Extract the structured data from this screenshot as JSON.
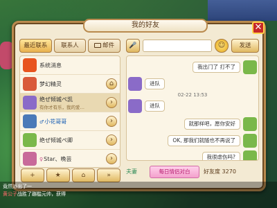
{
  "window": {
    "title": "我的好友",
    "close_symbol": "✕"
  },
  "tabs": [
    {
      "label": "最近联系",
      "active": true
    },
    {
      "label": "联系人",
      "active": false
    },
    {
      "label": "邮件",
      "active": false
    }
  ],
  "contacts": [
    {
      "name": "系统消息",
      "sub": "",
      "badge": "系统",
      "action": "",
      "avatar_color": "#e8541e"
    },
    {
      "name": "梦幻精灵",
      "sub": "",
      "badge": "",
      "action": "⌂",
      "avatar_color": "#d95a3a"
    },
    {
      "name": "绝ぜ倾城ぺ凯",
      "sub": "有你才有乐，我的爱…",
      "badge": "",
      "action": "›",
      "avatar_color": "#8a6bc8",
      "selected": true
    },
    {
      "name": "小花哥哥",
      "sub": "",
      "badge": "",
      "action": "›",
      "avatar_color": "#4a7ab8",
      "gender": "♂"
    },
    {
      "name": "绝ぜ倾城ぺ卿",
      "sub": "",
      "badge": "",
      "action": "›",
      "avatar_color": "#7ab84a"
    },
    {
      "name": "Star、晚芸",
      "sub": "",
      "badge": "",
      "action": "›",
      "avatar_color": "#c86a9a",
      "gender": "♀"
    }
  ],
  "bottom_buttons": [
    "+",
    "★",
    "⌂",
    "»"
  ],
  "chat_input": {
    "mic_symbol": "🎤",
    "placeholder": "",
    "emoji_symbol": "☺",
    "send_label": "发送"
  },
  "messages": [
    {
      "side": "right",
      "text": "我出门了 打不了"
    },
    {
      "side": "left",
      "text": "进队"
    },
    {
      "timestamp": "02-22 13:53"
    },
    {
      "side": "left",
      "text": "进队"
    },
    {
      "side": "right",
      "text": "就那样吧，愿你安好"
    },
    {
      "side": "right",
      "text": "OK, 那我们就随也不再说了"
    },
    {
      "side": "right",
      "text": "我很虐伤吗?"
    }
  ],
  "footer": {
    "relation": "夫妻",
    "daily_label": "每日情侣对白",
    "favor_label": "好友度",
    "favor_value": "3270"
  },
  "world_chat": [
    {
      "who": "",
      "text": "竟然派出了一"
    },
    {
      "who": "黄公子",
      "text": "战胜了蹦槛元帅，获得"
    }
  ]
}
